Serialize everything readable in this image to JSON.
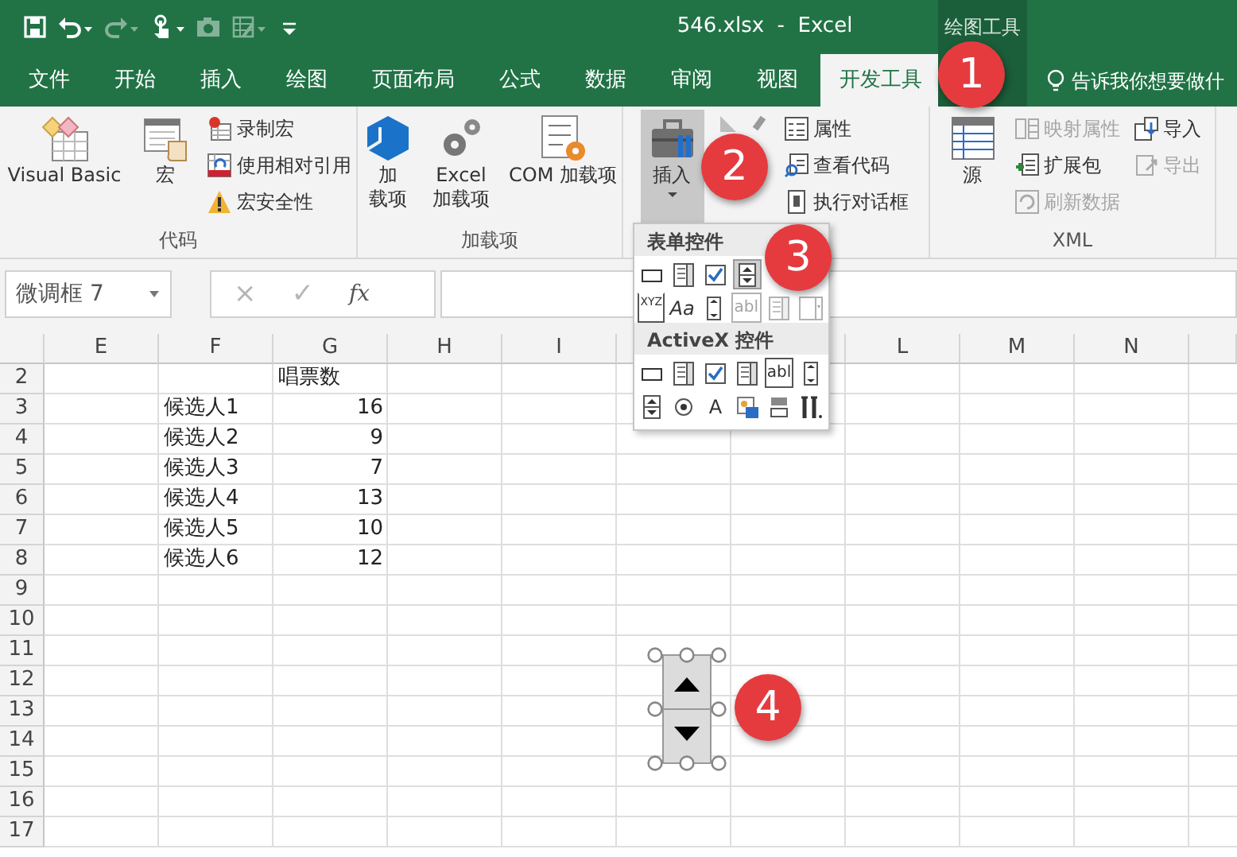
{
  "title_bar": {
    "quick_access": [
      {
        "caret": false,
        "disabled": false
      },
      {
        "caret": true,
        "disabled": false
      },
      {
        "caret": true,
        "disabled": true
      },
      {
        "caret": true,
        "disabled": false
      },
      {
        "caret": false,
        "disabled": true
      },
      {
        "caret": true,
        "disabled": true
      },
      {
        "caret": false,
        "disabled": false
      }
    ],
    "title": "546.xlsx  -  Excel",
    "context_label": "绘图工具"
  },
  "tabs": [
    {
      "label": "文件",
      "selected": false
    },
    {
      "label": "开始",
      "selected": false
    },
    {
      "label": "插入",
      "selected": false
    },
    {
      "label": "绘图",
      "selected": false
    },
    {
      "label": "页面布局",
      "selected": false
    },
    {
      "label": "公式",
      "selected": false
    },
    {
      "label": "数据",
      "selected": false
    },
    {
      "label": "审阅",
      "selected": false
    },
    {
      "label": "视图",
      "selected": false
    },
    {
      "label": "开发工具",
      "selected": true
    }
  ],
  "tell_me": "告诉我你想要做什",
  "ribbon_groups": [
    {
      "label": "代码",
      "items": [
        {
          "kind": "large",
          "lines": [
            "Visual Basic"
          ],
          "pressed": false,
          "caret": false
        },
        {
          "kind": "large",
          "lines": [
            "宏"
          ],
          "pressed": false,
          "caret": false
        },
        {
          "kind": "stack",
          "entries": [
            {
              "label": "录制宏",
              "disabled": false
            },
            {
              "label": "使用相对引用",
              "disabled": false
            },
            {
              "label": "宏安全性",
              "disabled": false
            }
          ]
        }
      ]
    },
    {
      "label": "加载项",
      "items": [
        {
          "kind": "large",
          "lines": [
            "加",
            "载项"
          ],
          "pressed": false,
          "caret": false
        },
        {
          "kind": "large",
          "lines": [
            "Excel",
            "加载项"
          ],
          "pressed": false,
          "caret": false
        },
        {
          "kind": "large",
          "lines": [
            "COM 加载项"
          ],
          "pressed": false,
          "caret": false
        }
      ]
    },
    {
      "items": [
        {
          "kind": "large",
          "lines": [
            "插入"
          ],
          "pressed": true,
          "caret": true
        },
        {
          "kind": "large",
          "pressed": false
        },
        {
          "kind": "stack",
          "entries": [
            {
              "label": "属性",
              "disabled": false
            },
            {
              "label": "查看代码",
              "disabled": false
            },
            {
              "label": "执行对话框",
              "disabled": false
            }
          ]
        }
      ]
    },
    {
      "label": "XML",
      "items": [
        {
          "kind": "large",
          "lines": [
            "源"
          ],
          "pressed": false,
          "caret": false
        },
        {
          "kind": "stack",
          "entries": [
            {
              "label": "映射属性",
              "disabled": true
            },
            {
              "label": "扩展包",
              "disabled": false
            },
            {
              "label": "刷新数据",
              "disabled": true
            }
          ]
        },
        {
          "kind": "stack",
          "entries": [
            {
              "label": "导入",
              "disabled": false
            },
            {
              "label": "导出",
              "disabled": true
            }
          ]
        }
      ]
    }
  ],
  "formula_bar": {
    "name_box": "微调框 7",
    "buttons": [
      "×",
      "✓",
      "fx"
    ]
  },
  "insert_menu": {
    "sections": [
      {
        "title": "表单控件",
        "rows": [
          [
            {
              "kind": "button",
              "disabled": false,
              "selected": false
            },
            {
              "kind": "listbox",
              "disabled": false,
              "selected": false
            },
            {
              "kind": "checkbox",
              "disabled": false,
              "selected": false
            },
            {
              "kind": "spinner",
              "disabled": false,
              "selected": true
            }
          ],
          [
            {
              "kind": "groupbox",
              "glyph": "XYZ",
              "disabled": false,
              "selected": false
            },
            {
              "kind": "label",
              "glyph": "Aa",
              "disabled": false,
              "selected": false
            },
            {
              "kind": "scrollbar",
              "disabled": false,
              "selected": false
            },
            {
              "kind": "textfield",
              "glyph": "abl",
              "disabled": true,
              "selected": false
            },
            {
              "kind": "listbox",
              "disabled": true,
              "selected": false
            },
            {
              "kind": "combobox",
              "disabled": true,
              "selected": false
            }
          ]
        ]
      },
      {
        "title": "ActiveX 控件",
        "rows": [
          [
            {
              "kind": "button",
              "disabled": false,
              "selected": false
            },
            {
              "kind": "listbox",
              "disabled": false,
              "selected": false
            },
            {
              "kind": "checkbox",
              "disabled": false,
              "selected": false
            },
            {
              "kind": "listbox",
              "disabled": false,
              "selected": false
            },
            {
              "kind": "textfield",
              "glyph": "abl",
              "disabled": false,
              "selected": false
            },
            {
              "kind": "scrollbar",
              "disabled": false,
              "selected": false
            }
          ],
          [
            {
              "kind": "spinner",
              "disabled": false,
              "selected": false
            },
            {
              "kind": "option",
              "disabled": false,
              "selected": false
            },
            {
              "kind": "label",
              "glyph": "A",
              "disabled": false,
              "selected": false
            },
            {
              "kind": "image",
              "disabled": false,
              "selected": false
            },
            {
              "kind": "toggle",
              "disabled": false,
              "selected": false
            },
            {
              "kind": "tools",
              "disabled": false,
              "selected": false
            }
          ]
        ]
      }
    ]
  },
  "sheet": {
    "columns": [
      "E",
      "F",
      "G",
      "H",
      "I",
      "L",
      "M",
      "N"
    ],
    "rows": [
      {
        "number": "2",
        "column_g": {
          "text": "唱票数",
          "kind": "text"
        }
      },
      {
        "number": "3",
        "column_f": {
          "text": "候选人1",
          "kind": "text"
        },
        "column_g": {
          "text": "16",
          "kind": "number"
        }
      },
      {
        "number": "4",
        "column_f": {
          "text": "候选人2",
          "kind": "text"
        },
        "column_g": {
          "text": "9",
          "kind": "number"
        }
      },
      {
        "number": "5",
        "column_f": {
          "text": "候选人3",
          "kind": "text"
        },
        "column_g": {
          "text": "7",
          "kind": "number"
        }
      },
      {
        "number": "6",
        "column_f": {
          "text": "候选人4",
          "kind": "text"
        },
        "column_g": {
          "text": "13",
          "kind": "number"
        }
      },
      {
        "number": "7",
        "column_f": {
          "text": "候选人5",
          "kind": "text"
        },
        "column_g": {
          "text": "10",
          "kind": "number"
        }
      },
      {
        "number": "8",
        "column_f": {
          "text": "候选人6",
          "kind": "text"
        },
        "column_g": {
          "text": "12",
          "kind": "number"
        }
      },
      {
        "number": "9"
      },
      {
        "number": "10"
      },
      {
        "number": "11"
      },
      {
        "number": "12"
      },
      {
        "number": "13"
      },
      {
        "number": "14"
      },
      {
        "number": "15"
      },
      {
        "number": "16"
      },
      {
        "number": "17"
      }
    ],
    "spinner": {
      "selected": true
    }
  },
  "callouts": [
    "1",
    "2",
    "3",
    "4"
  ]
}
